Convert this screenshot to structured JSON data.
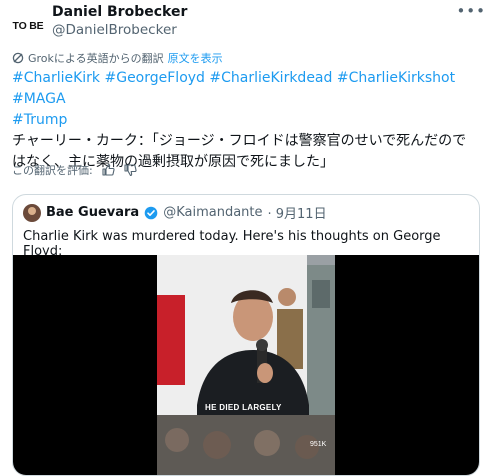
{
  "author": {
    "avatar_text": "TO BE",
    "display_name": "Daniel Brobecker",
    "handle": "@DanielBrobecker"
  },
  "translation": {
    "notice": "Grokによる英語からの翻訳",
    "show_original": "原文を表示"
  },
  "tweet": {
    "hashtags_line1": "#CharlieKirk #GeorgeFloyd #CharlieKirkdead #CharlieKirkshot #MAGA",
    "hashtags_line2": "#Trump",
    "body_line1": "チャーリー・カーク：「ジョージ・フロイドは警察官のせいで死んだので",
    "body_line2": "はなく、主に薬物の過剰摂取が原因で死にました」"
  },
  "rate": {
    "label": "この翻訳を評価:"
  },
  "quote": {
    "name": "Bae Guevara",
    "handle": "@Kaimandante",
    "date": "· 9月11日",
    "text": "Charlie Kirk was murdered today. Here's his thoughts on George Floyd:",
    "video": {
      "caption": "HE DIED LARGELY",
      "views": "951K"
    }
  }
}
